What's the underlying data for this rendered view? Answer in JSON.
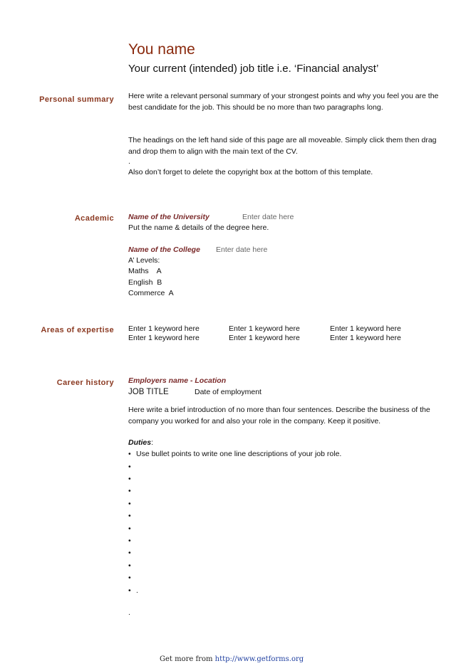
{
  "header": {
    "name": "You name",
    "job_title": "Your current (intended) job title i.e. ‘Financial analyst’"
  },
  "sections": {
    "personal_summary": {
      "heading": "Personal summary",
      "paragraphs": [
        "Here write a relevant personal summary of your strongest points and why you feel you are the best candidate for the job. This should be no more than two paragraphs long.",
        "The headings on the left hand side of this page are all moveable. Simply click them then drag and drop them to align with the main text of the CV.",
        ".",
        "Also don’t forget to delete the copyright box at the bottom of this template."
      ]
    },
    "academic": {
      "heading": "Academic",
      "university": {
        "name": "Name of the University",
        "date": "Enter date here",
        "details": "Put the name & details of the degree here."
      },
      "college": {
        "name": "Name of the College",
        "date": "Enter date here",
        "lines": [
          "A’ Levels:",
          "Maths    A",
          "English  B",
          "Commerce  A"
        ]
      }
    },
    "expertise": {
      "heading": "Areas of expertise",
      "keywords": [
        [
          "Enter 1 keyword here",
          "Enter 1 keyword here",
          "Enter 1 keyword here"
        ],
        [
          "Enter 1 keyword here",
          "Enter 1 keyword here",
          "Enter 1 keyword here"
        ]
      ]
    },
    "career": {
      "heading": "Career history",
      "employer": "Employers name - Location",
      "job_title": "JOB TITLE",
      "date": "Date of employment",
      "intro": "Here write a brief introduction of no more than four sentences. Describe the business of the company you worked for and also your role in the company. Keep it positive.",
      "duties_label": "Duties",
      "duties_colon": ":",
      "bullet_glyph": "•",
      "duties": [
        "Use bullet points to write one line descriptions of your job role.",
        "",
        "",
        "",
        "",
        "",
        "",
        "",
        "",
        "",
        "",
        "."
      ],
      "trailing": "."
    }
  },
  "footer": {
    "prefix": "Get more from ",
    "link": "http://www.getforms.org"
  }
}
